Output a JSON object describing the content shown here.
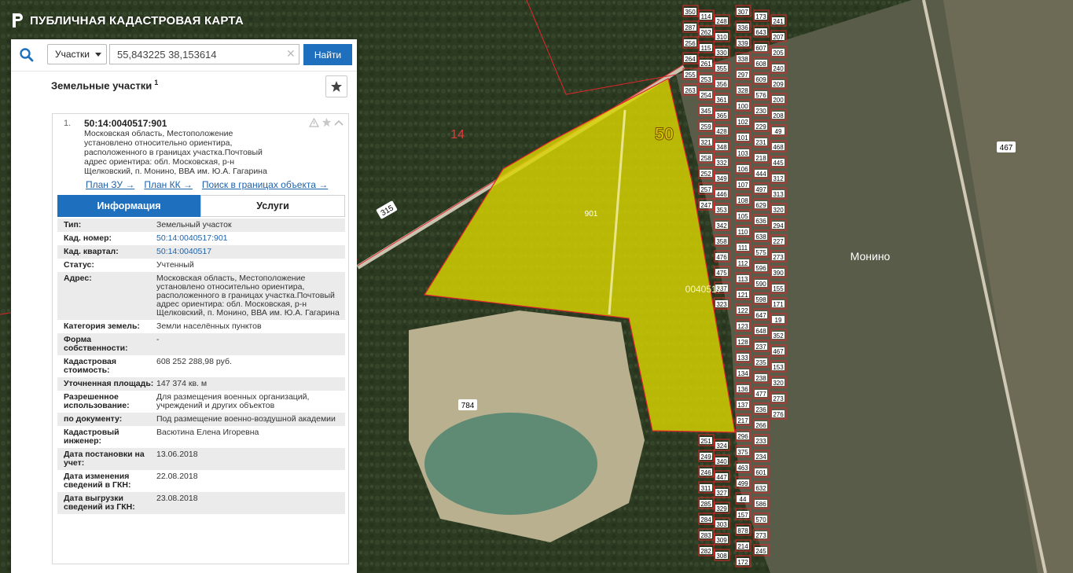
{
  "header": {
    "title": "ПУБЛИЧНАЯ КАДАСТРОВАЯ КАРТА"
  },
  "search": {
    "type_selected": "Участки",
    "query": "55,843225 38,153614",
    "find_label": "Найти"
  },
  "results": {
    "title": "Земельные участки",
    "count": "1"
  },
  "card": {
    "index": "1.",
    "cad_number": "50:14:0040517:901",
    "address_lines": [
      "Московская область, Местоположение",
      "установлено относительно ориентира,",
      "расположенного в границах участка.Почтовый",
      "адрес ориентира: обл. Московская, р-н",
      "Щелковский, п. Монино, ВВА им. Ю.А. Гагарина"
    ],
    "links": [
      "План ЗУ →",
      "План КК →",
      "Поиск в границах объекта →"
    ],
    "tabs": [
      "Информация",
      "Услуги"
    ],
    "info": [
      {
        "k": "Тип:",
        "v": "Земельный участок"
      },
      {
        "k": "Кад. номер:",
        "v": "50:14:0040517:901",
        "link": true
      },
      {
        "k": "Кад. квартал:",
        "v": "50:14:0040517",
        "link": true
      },
      {
        "k": "Статус:",
        "v": "Учтенный"
      },
      {
        "k": "Адрес:",
        "v": "Московская область, Местоположение установлено относительно ориентира, расположенного в границах участка.Почтовый адрес ориентира: обл. Московская, р-н Щелковский, п. Монино, ВВА им. Ю.А. Гагарина"
      },
      {
        "k": "Категория земель:",
        "v": "Земли населённых пунктов"
      },
      {
        "k": "Форма собственности:",
        "v": "-"
      },
      {
        "k": "Кадастровая стоимость:",
        "v": "608 252 288,98 руб."
      },
      {
        "k": "Уточненная площадь:",
        "v": "147 374 кв. м"
      },
      {
        "k": "Разрешенное использование:",
        "v": "Для размещения военных организаций, учреждений и других объектов"
      },
      {
        "k": "по документу:",
        "v": "Под размещение военно-воздушной академии"
      },
      {
        "k": "Кадастровый инженер:",
        "v": "Васютина Елена Игоревна"
      },
      {
        "k": "Дата постановки на учет:",
        "v": "13.06.2018"
      },
      {
        "k": "Дата изменения сведений в ГКН:",
        "v": "22.08.2018"
      },
      {
        "k": "Дата выгрузки сведений из ГКН:",
        "v": "23.08.2018"
      }
    ]
  },
  "map": {
    "region_label": "50",
    "district_label": "14",
    "parcel_label": "901",
    "quarter_label": "0040517",
    "town_label": "Монино",
    "road_labels": [
      "315",
      "315",
      "784",
      "467"
    ],
    "lot_numbers": [
      "350",
      "287",
      "256",
      "264",
      "255",
      "263",
      "114",
      "262",
      "115",
      "261",
      "253",
      "254",
      "345",
      "259",
      "321",
      "258",
      "252",
      "257",
      "247",
      "251",
      "249",
      "246",
      "311",
      "285",
      "284",
      "283",
      "282",
      "248",
      "310",
      "330",
      "355",
      "356",
      "361",
      "365",
      "428",
      "348",
      "332",
      "349",
      "446",
      "353",
      "342",
      "358",
      "476",
      "475",
      "337",
      "323",
      "324",
      "340",
      "447",
      "327",
      "329",
      "303",
      "309",
      "308",
      "307",
      "336",
      "339",
      "338",
      "297",
      "328",
      "100",
      "102",
      "101",
      "103",
      "106",
      "107",
      "108",
      "105",
      "110",
      "111",
      "112",
      "113",
      "121",
      "122",
      "123",
      "128",
      "133",
      "134",
      "136",
      "137",
      "217",
      "296",
      "375",
      "463",
      "499",
      "44",
      "157",
      "878",
      "214",
      "172",
      "173",
      "643",
      "607",
      "608",
      "609",
      "576",
      "230",
      "229",
      "231",
      "218",
      "444",
      "497",
      "629",
      "636",
      "638",
      "575",
      "596",
      "590",
      "598",
      "647",
      "648",
      "237",
      "235",
      "238",
      "477",
      "236",
      "266",
      "233",
      "234",
      "601",
      "632",
      "586",
      "570",
      "273",
      "245",
      "241",
      "207",
      "205",
      "240",
      "209",
      "200",
      "208",
      "49",
      "468",
      "445",
      "312",
      "313",
      "320",
      "294",
      "227",
      "273",
      "390",
      "155",
      "171",
      "19",
      "352",
      "467",
      "153",
      "320",
      "273",
      "276"
    ],
    "colors": {
      "parcel_fill": "#d9d400",
      "boundary": "#e0262b",
      "ui_blue": "#1f6fbf"
    }
  }
}
